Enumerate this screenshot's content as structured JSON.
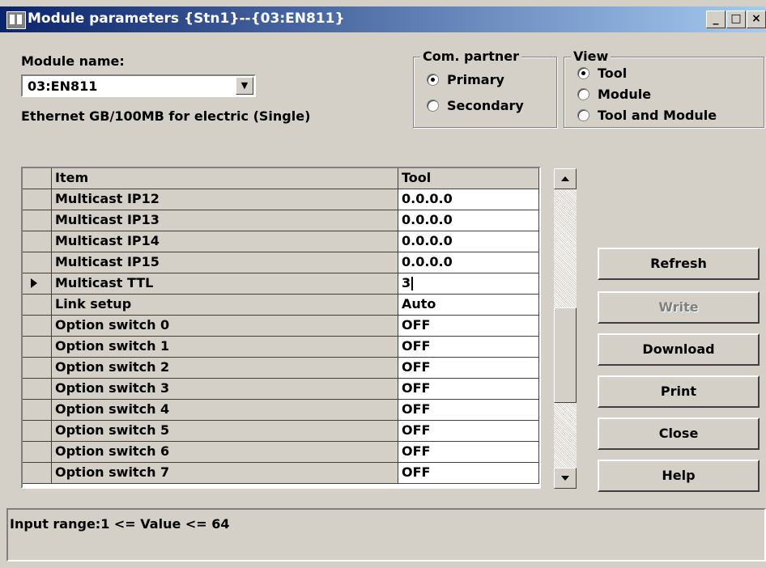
{
  "window": {
    "title": "Module parameters {Stn1}--{03:EN811}",
    "controls": {
      "minimize": "_",
      "maximize": "□",
      "close": "×"
    }
  },
  "module": {
    "name_label": "Module name:",
    "name_value": "03:EN811",
    "description": "Ethernet GB/100MB for electric (Single)"
  },
  "com_partner": {
    "title": "Com. partner",
    "options": [
      {
        "label": "Primary",
        "selected": true
      },
      {
        "label": "Secondary",
        "selected": false
      }
    ]
  },
  "view": {
    "title": "View",
    "options": [
      {
        "label": "Tool",
        "selected": true
      },
      {
        "label": "Module",
        "selected": false
      },
      {
        "label": "Tool and Module",
        "selected": false
      }
    ]
  },
  "grid": {
    "headers": {
      "item": "Item",
      "tool": "Tool"
    },
    "rows": [
      {
        "item": "Multicast IP12",
        "tool": "0.0.0.0"
      },
      {
        "item": "Multicast IP13",
        "tool": "0.0.0.0"
      },
      {
        "item": "Multicast IP14",
        "tool": "0.0.0.0"
      },
      {
        "item": "Multicast IP15",
        "tool": "0.0.0.0"
      },
      {
        "item": "Multicast TTL",
        "tool": "3"
      },
      {
        "item": "Link setup",
        "tool": "Auto"
      },
      {
        "item": "Option switch 0",
        "tool": "OFF"
      },
      {
        "item": "Option switch 1",
        "tool": "OFF"
      },
      {
        "item": "Option switch 2",
        "tool": "OFF"
      },
      {
        "item": "Option switch 3",
        "tool": "OFF"
      },
      {
        "item": "Option switch 4",
        "tool": "OFF"
      },
      {
        "item": "Option switch 5",
        "tool": "OFF"
      },
      {
        "item": "Option switch 6",
        "tool": "OFF"
      },
      {
        "item": "Option switch 7",
        "tool": "OFF"
      }
    ],
    "current_row": 4
  },
  "buttons": {
    "refresh": "Refresh",
    "write": "Write",
    "download": "Download",
    "print": "Print",
    "close": "Close",
    "help": "Help"
  },
  "status": {
    "text": "Input range:1 <= Value <= 64"
  }
}
